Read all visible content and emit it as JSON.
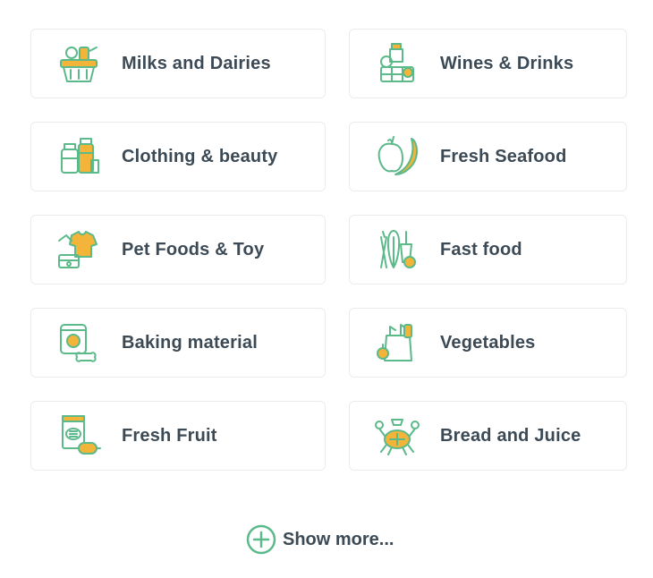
{
  "categories": [
    {
      "label": "Milks and Dairies",
      "icon": "basket-icon"
    },
    {
      "label": "Wines & Drinks",
      "icon": "drinks-icon"
    },
    {
      "label": "Clothing & beauty",
      "icon": "jars-icon"
    },
    {
      "label": "Fresh Seafood",
      "icon": "fruit-icon"
    },
    {
      "label": "Pet Foods & Toy",
      "icon": "pet-clothes-icon"
    },
    {
      "label": "Fast food",
      "icon": "vegetables-icon"
    },
    {
      "label": "Baking material",
      "icon": "pet-food-can-icon"
    },
    {
      "label": "Vegetables",
      "icon": "grocery-bag-icon"
    },
    {
      "label": "Fresh Fruit",
      "icon": "snack-bag-icon"
    },
    {
      "label": "Bread and Juice",
      "icon": "crab-icon"
    }
  ],
  "show_more": {
    "label": "Show more...",
    "icon": "plus-circle-icon"
  },
  "colors": {
    "icon_green": "#5cb98a",
    "icon_yellow": "#f2b53a",
    "text": "#3c4a56",
    "border": "#e9ecef"
  }
}
